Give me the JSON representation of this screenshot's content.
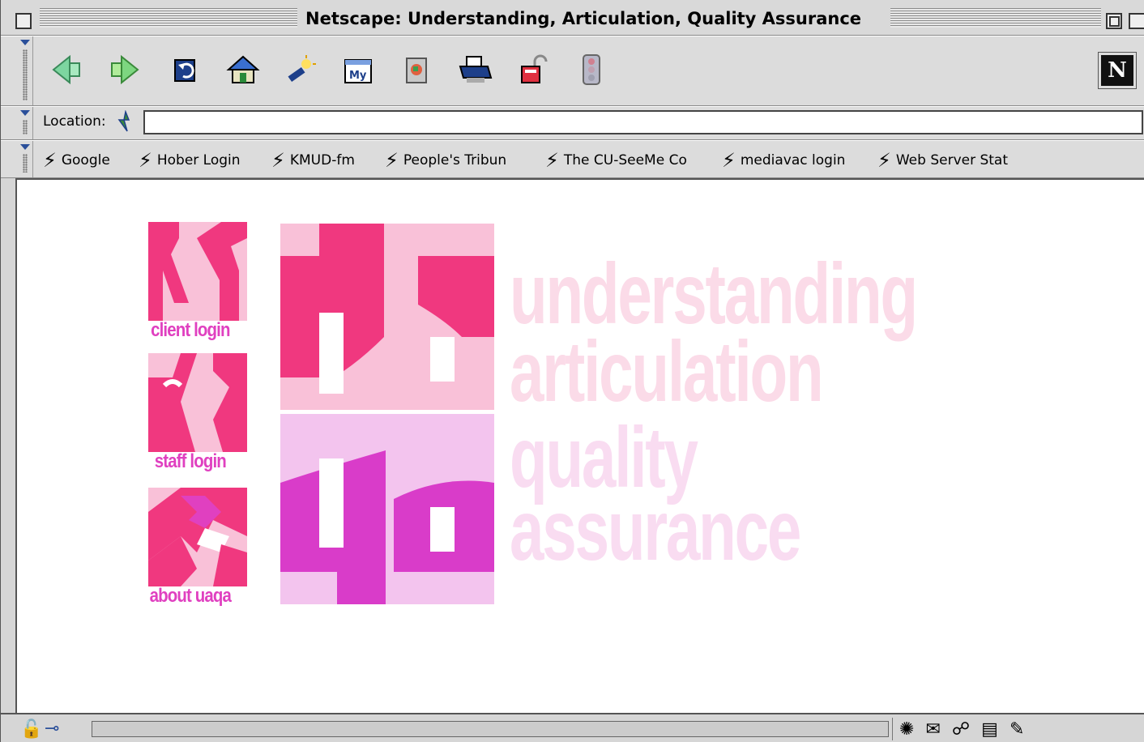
{
  "window": {
    "title": "Netscape: Understanding, Articulation, Quality Assurance"
  },
  "navbar": {
    "buttons": [
      {
        "name": "back-icon",
        "glyph": "◀"
      },
      {
        "name": "forward-icon",
        "glyph": "▶"
      },
      {
        "name": "reload-icon",
        "glyph": "↻"
      },
      {
        "name": "home-icon",
        "glyph": "⌂"
      },
      {
        "name": "search-icon",
        "glyph": "🔦"
      },
      {
        "name": "my-netscape-icon",
        "glyph": "My"
      },
      {
        "name": "images-icon",
        "glyph": "▣"
      },
      {
        "name": "print-icon",
        "glyph": "⎙"
      },
      {
        "name": "security-icon",
        "glyph": "🔓"
      },
      {
        "name": "stop-icon",
        "glyph": "⛔"
      }
    ],
    "logo": "N"
  },
  "location": {
    "label": "Location:",
    "value": ""
  },
  "bookmarks": [
    "Google",
    "Hober Login",
    "KMUD-fm",
    "People's Tribun",
    "The CU-SeeMe Co",
    "mediavac login",
    "Web Server Stat"
  ],
  "page": {
    "links": [
      "client login",
      "staff login",
      "about uaqa"
    ],
    "tagline": [
      "understanding",
      "articulation",
      "quality",
      "assurance"
    ],
    "colors": {
      "hot_pink": "#f0387f",
      "light_pink": "#f9c1d8",
      "lavender": "#f3c4ee",
      "magenta": "#d93cc9",
      "tagline": "#fbdbe8"
    }
  }
}
